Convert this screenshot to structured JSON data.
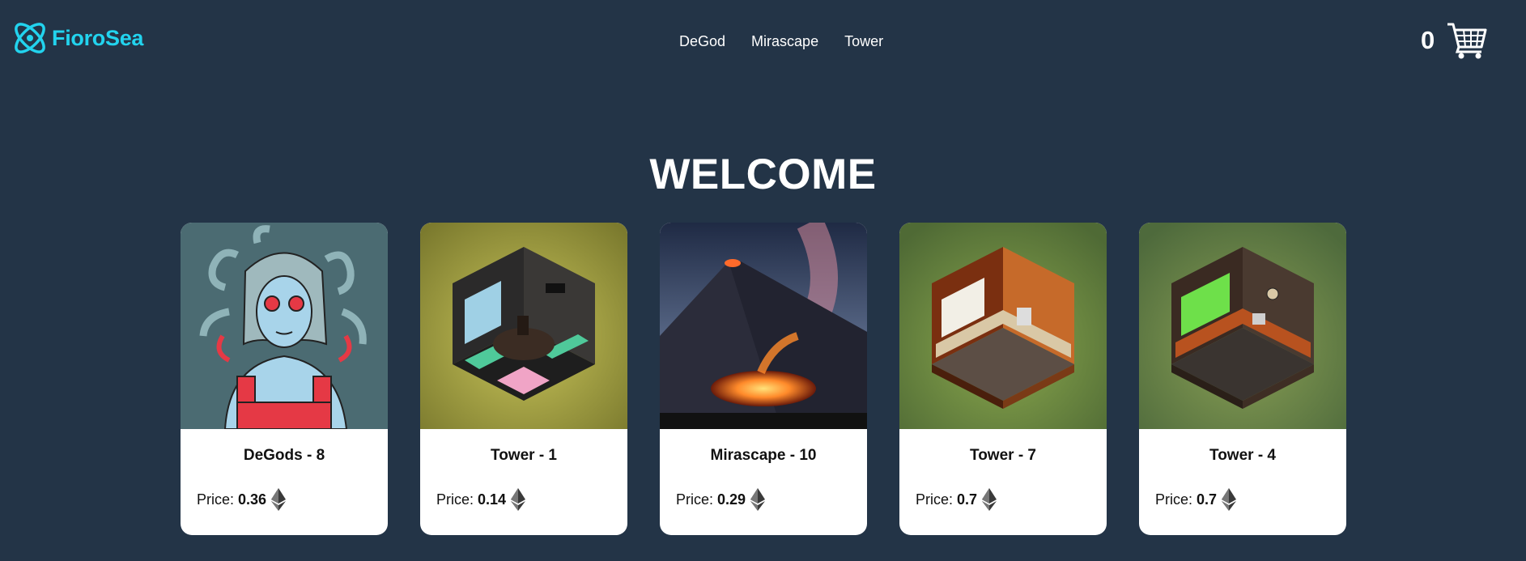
{
  "brand": {
    "name": "FioroSea",
    "color": "#22d3ee"
  },
  "nav": [
    {
      "label": "DeGod"
    },
    {
      "label": "Mirascape"
    },
    {
      "label": "Tower"
    }
  ],
  "cart": {
    "count": "0",
    "icon": "shopping-cart-icon"
  },
  "hero": {
    "title": "WELCOME"
  },
  "price_label": "Price:",
  "cards": [
    {
      "title": "DeGods - 8",
      "price": "0.36",
      "image": "medusa-illustration",
      "currency_icon": "ethereum-icon"
    },
    {
      "title": "Tower - 1",
      "price": "0.14",
      "image": "isometric-meeting-room",
      "currency_icon": "ethereum-icon"
    },
    {
      "title": "Mirascape - 10",
      "price": "0.29",
      "image": "volcano-eruption",
      "currency_icon": "ethereum-icon"
    },
    {
      "title": "Tower - 7",
      "price": "0.7",
      "image": "isometric-orange-kitchen",
      "currency_icon": "ethereum-icon"
    },
    {
      "title": "Tower - 4",
      "price": "0.7",
      "image": "isometric-green-kitchen",
      "currency_icon": "ethereum-icon"
    }
  ],
  "colors": {
    "background": "#233447",
    "card": "#ffffff",
    "accent": "#22d3ee"
  }
}
